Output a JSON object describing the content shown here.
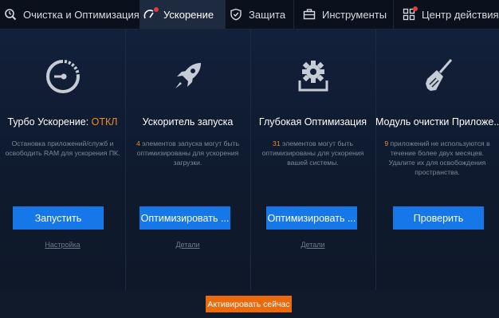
{
  "tabs": [
    {
      "label": "Очистка и Оптимизация",
      "icon": "search-icon"
    },
    {
      "label": "Ускорение",
      "icon": "speedometer-icon",
      "active": true
    },
    {
      "label": "Защита",
      "icon": "shield-icon"
    },
    {
      "label": "Инструменты",
      "icon": "toolbox-icon"
    },
    {
      "label": "Центр действия",
      "icon": "grid-icon"
    }
  ],
  "columns": [
    {
      "icon": "speedometer-icon",
      "title": "Турбо Ускорение: ",
      "title_state": "ОТКЛ",
      "desc": "Остановка приложений/служб и освободить  RAM для ускорения ПК.",
      "button": "Запустить",
      "link": "Настройка"
    },
    {
      "icon": "rocket-icon",
      "title": "Ускоритель запуска",
      "desc_count": "4",
      "desc": " элементов запуска могут быть оптимизированы для ускорения загрузки.",
      "button": "Оптимизировать ...",
      "link": "Детали"
    },
    {
      "icon": "gear-icon",
      "title": "Глубокая Оптимизация",
      "desc_count": "31",
      "desc": " элементов могут быть оптимизированы для ускорения вашей системы.",
      "button": "Оптимизировать ...",
      "link": "Детали"
    },
    {
      "icon": "broom-icon",
      "title": "Модуль очистки Приложе...",
      "desc_count": "9",
      "desc": " приложений не используются в течение более двух месяцев. Удалите их для освобождения пространства.",
      "button": "Проверить"
    }
  ],
  "footer": {
    "activate_label": "Активировать сейчас"
  },
  "colors": {
    "accent": "#1677e8",
    "highlight": "#f08a22",
    "activate": "#ec6a0e"
  }
}
